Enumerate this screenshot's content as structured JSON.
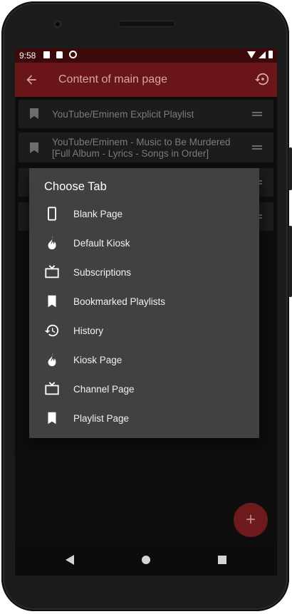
{
  "status_bar": {
    "time": "9:58"
  },
  "app_bar": {
    "title": "Content of main page"
  },
  "tab_list": [
    {
      "label": "YouTube/Eminem Explicit Playlist"
    },
    {
      "label_line1": "YouTube/Eminem - Music to Be Murdered",
      "label_line2": "[Full Album - Lyrics - Songs in Order]"
    }
  ],
  "dialog": {
    "title": "Choose Tab",
    "items": [
      {
        "label": "Blank Page",
        "icon": "phone-icon"
      },
      {
        "label": "Default Kiosk",
        "icon": "fire-icon"
      },
      {
        "label": "Subscriptions",
        "icon": "tv-icon"
      },
      {
        "label": "Bookmarked Playlists",
        "icon": "bookmark-icon"
      },
      {
        "label": "History",
        "icon": "history-icon"
      },
      {
        "label": "Kiosk Page",
        "icon": "fire-icon"
      },
      {
        "label": "Channel Page",
        "icon": "tv-icon"
      },
      {
        "label": "Playlist Page",
        "icon": "bookmark-icon"
      }
    ]
  },
  "fab": {
    "symbol": "+"
  },
  "colors": {
    "app_bar": "#6a1518",
    "status_bar": "#3c0a0b",
    "dialog_bg": "#414141",
    "fab": "#6e1a1c"
  }
}
